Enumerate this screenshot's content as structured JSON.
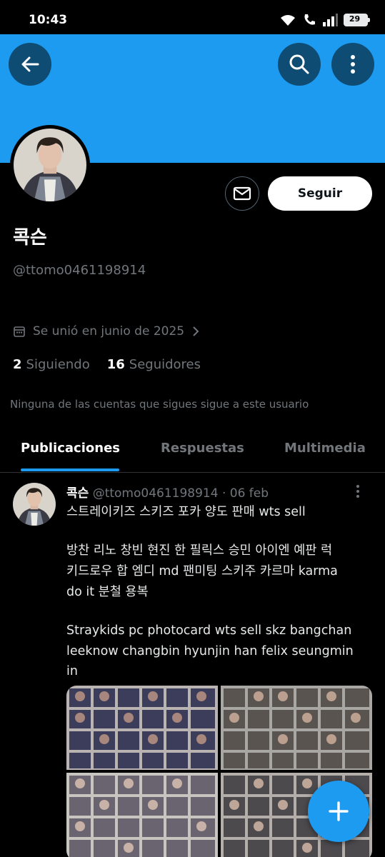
{
  "status_bar": {
    "time": "10:43",
    "battery": "29"
  },
  "colors": {
    "banner": "#1d9bf0",
    "accent": "#1d9bf0",
    "nav_button": "#0f4c73"
  },
  "icons": {
    "back": "arrow-left-icon",
    "search": "search-icon",
    "more": "more-vertical-icon",
    "message": "mail-icon",
    "calendar": "calendar-icon",
    "compose": "plus-icon"
  },
  "profile": {
    "display_name": "콕슨",
    "handle": "@ttomo0461198914",
    "joined": "Se unió en junio de 2025",
    "following_count": "2",
    "following_label": "Siguiendo",
    "followers_count": "16",
    "followers_label": "Seguidores",
    "mutuals_text": "Ninguna de las cuentas que sigues sigue a este usuario",
    "follow_button": "Seguir"
  },
  "tabs": [
    {
      "label": "Publicaciones",
      "active": true
    },
    {
      "label": "Respuestas",
      "active": false
    },
    {
      "label": "Multimedia",
      "active": false
    }
  ],
  "post": {
    "name": "콕슨",
    "handle_date": "@ttomo0461198914 · 06 feb",
    "lines": [
      "스트레이키즈 스키즈 포카 양도 판매 wts sell",
      "",
      "방찬 리노 창빈 현진 한 필릭스 승민 아이엔 예판 럭",
      "키드로우 합 엠디 md 팬미팅 스키주 카르마 karma",
      "do it 분철 용복",
      "",
      "Straykids pc photocard wts sell skz bangchan",
      "leeknow changbin hyunjin han felix seungmin",
      "in"
    ]
  }
}
